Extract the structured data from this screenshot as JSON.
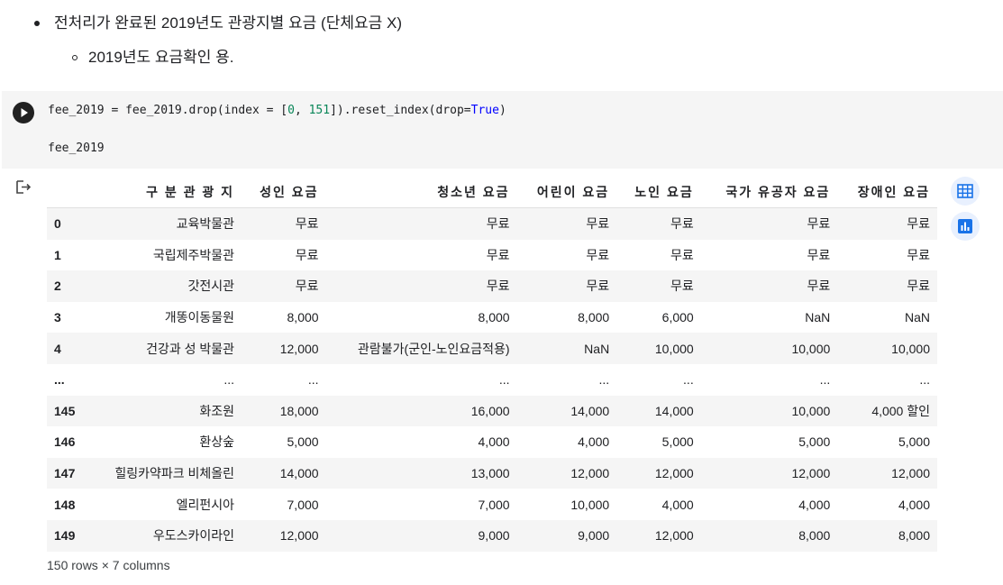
{
  "markdown": {
    "bullet1": "전처리가 완료된 2019년도 관광지별 요금 (단체요금 X)",
    "bullet2": "2019년도 요금확인 용."
  },
  "code": {
    "line1_a": "fee_2019 = fee_2019.drop(index = [",
    "line1_n1": "0",
    "line1_b": ", ",
    "line1_n2": "151",
    "line1_c": "]).reset_index(drop=",
    "line1_kw": "True",
    "line1_d": ")",
    "line2": "fee_2019"
  },
  "table": {
    "columns": [
      "",
      "구 분 관 광 지",
      "성인 요금",
      "청소년 요금",
      "어린이 요금",
      "노인 요금",
      "국가 유공자 요금",
      "장애인 요금"
    ],
    "rows": [
      [
        "0",
        "교육박물관",
        "무료",
        "무료",
        "무료",
        "무료",
        "무료",
        "무료"
      ],
      [
        "1",
        "국립제주박물관",
        "무료",
        "무료",
        "무료",
        "무료",
        "무료",
        "무료"
      ],
      [
        "2",
        "갓전시관",
        "무료",
        "무료",
        "무료",
        "무료",
        "무료",
        "무료"
      ],
      [
        "3",
        "개똥이동물원",
        "8,000",
        "8,000",
        "8,000",
        "6,000",
        "NaN",
        "NaN"
      ],
      [
        "4",
        "건강과 성 박물관",
        "12,000",
        "관람불가(군인-노인요금적용)",
        "NaN",
        "10,000",
        "10,000",
        "10,000"
      ],
      [
        "...",
        "...",
        "...",
        "...",
        "...",
        "...",
        "...",
        "..."
      ],
      [
        "145",
        "화조원",
        "18,000",
        "16,000",
        "14,000",
        "14,000",
        "10,000",
        "4,000 할인"
      ],
      [
        "146",
        "환상숲",
        "5,000",
        "4,000",
        "4,000",
        "5,000",
        "5,000",
        "5,000"
      ],
      [
        "147",
        "힐링카약파크 비체올린",
        "14,000",
        "13,000",
        "12,000",
        "12,000",
        "12,000",
        "12,000"
      ],
      [
        "148",
        "엘리펀시아",
        "7,000",
        "7,000",
        "10,000",
        "4,000",
        "4,000",
        "4,000"
      ],
      [
        "149",
        "우도스카이라인",
        "12,000",
        "9,000",
        "9,000",
        "12,000",
        "8,000",
        "8,000"
      ]
    ]
  },
  "footer": "150 rows × 7 columns",
  "icons": {
    "run": "play-icon",
    "output": "output-arrow-icon",
    "table_view": "table-icon",
    "chart_suggest": "bar-chart-icon"
  },
  "colors": {
    "accent": "#1a73e8",
    "side_button_bg": "#e8f0fe"
  }
}
